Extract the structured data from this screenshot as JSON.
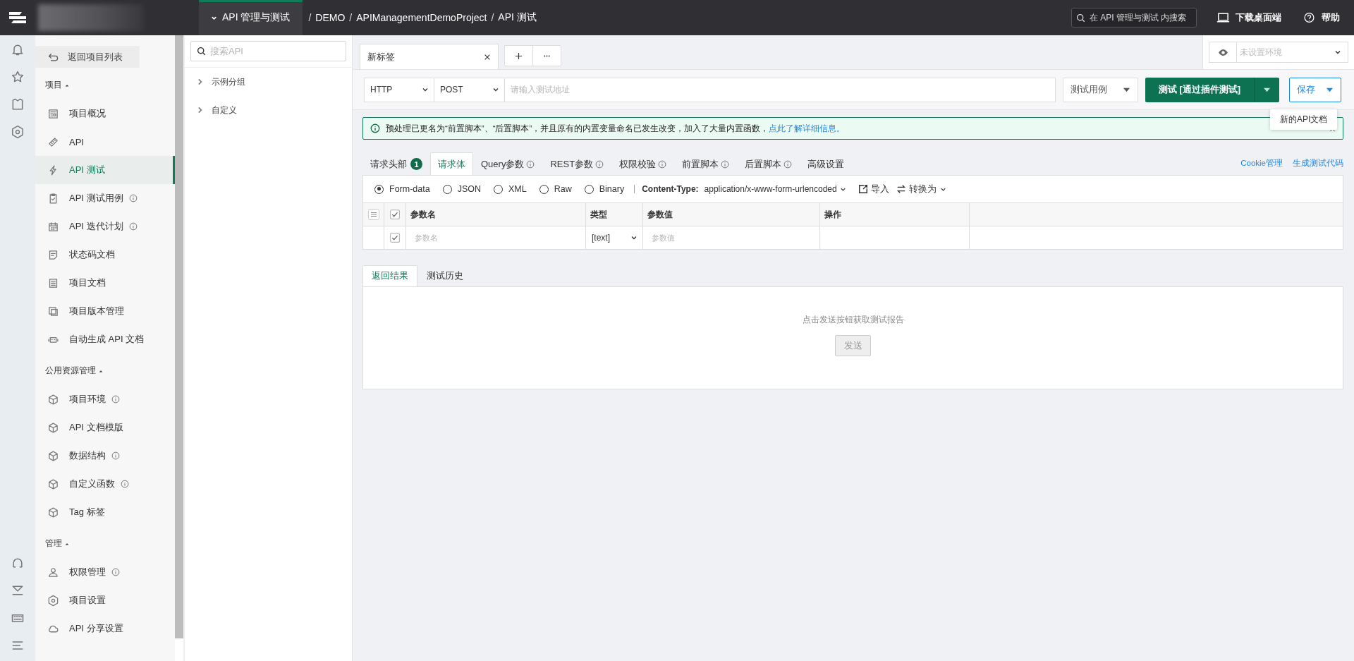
{
  "top_bar": {
    "module": "API 管理与测试",
    "breadcrumb_separator": "/",
    "breadcrumb": [
      "DEMO",
      "APIManagementDemoProject",
      "API 测试"
    ],
    "search_placeholder": "在 API 管理与测试 内搜索",
    "download": "下载桌面端",
    "help": "帮助"
  },
  "nav": {
    "back": "返回项目列表",
    "sections": [
      {
        "title": "项目",
        "expanded": true,
        "items": [
          {
            "label": "项目概况",
            "info": false,
            "selected": false
          },
          {
            "label": "API",
            "info": false,
            "selected": false
          },
          {
            "label": "API 测试",
            "info": false,
            "selected": true
          },
          {
            "label": "API 测试用例",
            "info": true,
            "selected": false
          },
          {
            "label": "API 迭代计划",
            "info": true,
            "selected": false
          },
          {
            "label": "状态码文档",
            "info": false,
            "selected": false
          },
          {
            "label": "项目文档",
            "info": false,
            "selected": false
          },
          {
            "label": "项目版本管理",
            "info": false,
            "selected": false
          },
          {
            "label": "自动生成 API 文档",
            "info": false,
            "selected": false
          }
        ]
      },
      {
        "title": "公用资源管理",
        "expanded": true,
        "items": [
          {
            "label": "项目环境",
            "info": true,
            "selected": false
          },
          {
            "label": "API 文档模版",
            "info": false,
            "selected": false
          },
          {
            "label": "数据结构",
            "info": true,
            "selected": false
          },
          {
            "label": "自定义函数",
            "info": true,
            "selected": false
          },
          {
            "label": "Tag 标签",
            "info": false,
            "selected": false
          }
        ]
      },
      {
        "title": "管理",
        "expanded": true,
        "items": [
          {
            "label": "权限管理",
            "info": true,
            "selected": false
          },
          {
            "label": "项目设置",
            "info": false,
            "selected": false
          },
          {
            "label": "API 分享设置",
            "info": false,
            "selected": false
          }
        ]
      }
    ]
  },
  "api_tree": {
    "search_placeholder": "搜索API",
    "groups": [
      {
        "label": "示例分组",
        "expanded": false
      },
      {
        "label": "自定义",
        "expanded": false
      }
    ]
  },
  "tabs": [
    {
      "label": "新标签",
      "selected": true
    }
  ],
  "environment": {
    "placeholder": "未设置环境"
  },
  "request": {
    "protocol": "HTTP",
    "method": "POST",
    "url_placeholder": "请输入测试地址",
    "case_button": "测试用例",
    "test_button": "测试 [通过插件测试]",
    "save_button": "保存",
    "save_menu": [
      "新的API文档"
    ]
  },
  "notice": {
    "text": "预处理已更名为“前置脚本”、“后置脚本”，并且原有的内置变量命名已发生改变，加入了大量内置函数，",
    "link": "点此了解详细信息。"
  },
  "request_tabs": [
    {
      "label": "请求头部",
      "badge": "1",
      "info": false,
      "selected": false
    },
    {
      "label": "请求体",
      "info": false,
      "selected": true
    },
    {
      "label": "Query参数",
      "info": true,
      "selected": false
    },
    {
      "label": "REST参数",
      "info": true,
      "selected": false
    },
    {
      "label": "权限校验",
      "info": true,
      "selected": false
    },
    {
      "label": "前置脚本",
      "info": true,
      "selected": false
    },
    {
      "label": "后置脚本",
      "info": true,
      "selected": false
    },
    {
      "label": "高级设置",
      "info": false,
      "selected": false
    }
  ],
  "request_links": [
    "Cookie管理",
    "生成测试代码"
  ],
  "body_types": [
    {
      "label": "Form-data",
      "selected": true
    },
    {
      "label": "JSON",
      "selected": false
    },
    {
      "label": "XML",
      "selected": false
    },
    {
      "label": "Raw",
      "selected": false
    },
    {
      "label": "Binary",
      "selected": false
    }
  ],
  "content_type": {
    "label": "Content-Type:",
    "value": "application/x-www-form-urlencoded"
  },
  "body_actions": [
    "导入",
    "转换为"
  ],
  "params_table": {
    "columns": [
      "参数名",
      "类型",
      "参数值",
      "操作"
    ],
    "header_checked": true,
    "rows": [
      {
        "checked": true,
        "name_placeholder": "参数名",
        "type": "[text]",
        "value_placeholder": "参数值"
      }
    ]
  },
  "result_tabs": [
    {
      "label": "返回结果",
      "selected": true
    },
    {
      "label": "测试历史",
      "selected": false
    }
  ],
  "result": {
    "message": "点击发送按钮获取测试报告",
    "send_button": "发送",
    "send_disabled": true
  }
}
